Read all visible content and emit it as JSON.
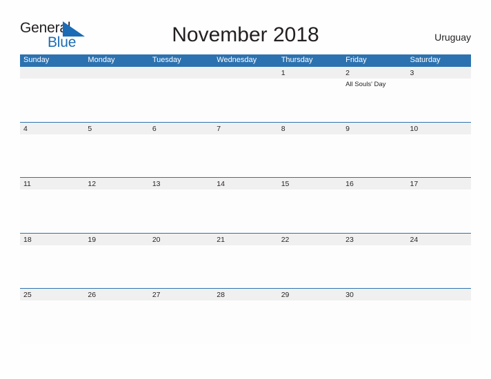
{
  "brand": {
    "name_part1": "General",
    "name_part2": "Blue",
    "triangle_icon": "blue-triangle-icon",
    "color_dark": "#231f20",
    "color_blue": "#1b6cb5"
  },
  "header": {
    "title": "November 2018",
    "region": "Uruguay"
  },
  "colors": {
    "header_blue": "#2c72b0",
    "band_gray": "#f0f0f0",
    "text": "#231f20",
    "page_background": "#fefefe"
  },
  "calendar": {
    "month": "November",
    "year": "2018",
    "weekdays": [
      "Sunday",
      "Monday",
      "Tuesday",
      "Wednesday",
      "Thursday",
      "Friday",
      "Saturday"
    ],
    "weeks": [
      [
        {
          "day": "",
          "event": ""
        },
        {
          "day": "",
          "event": ""
        },
        {
          "day": "",
          "event": ""
        },
        {
          "day": "",
          "event": ""
        },
        {
          "day": "1",
          "event": ""
        },
        {
          "day": "2",
          "event": "All Souls' Day"
        },
        {
          "day": "3",
          "event": ""
        }
      ],
      [
        {
          "day": "4",
          "event": ""
        },
        {
          "day": "5",
          "event": ""
        },
        {
          "day": "6",
          "event": ""
        },
        {
          "day": "7",
          "event": ""
        },
        {
          "day": "8",
          "event": ""
        },
        {
          "day": "9",
          "event": ""
        },
        {
          "day": "10",
          "event": ""
        }
      ],
      [
        {
          "day": "11",
          "event": ""
        },
        {
          "day": "12",
          "event": ""
        },
        {
          "day": "13",
          "event": ""
        },
        {
          "day": "14",
          "event": ""
        },
        {
          "day": "15",
          "event": ""
        },
        {
          "day": "16",
          "event": ""
        },
        {
          "day": "17",
          "event": ""
        }
      ],
      [
        {
          "day": "18",
          "event": ""
        },
        {
          "day": "19",
          "event": ""
        },
        {
          "day": "20",
          "event": ""
        },
        {
          "day": "21",
          "event": ""
        },
        {
          "day": "22",
          "event": ""
        },
        {
          "day": "23",
          "event": ""
        },
        {
          "day": "24",
          "event": ""
        }
      ],
      [
        {
          "day": "25",
          "event": ""
        },
        {
          "day": "26",
          "event": ""
        },
        {
          "day": "27",
          "event": ""
        },
        {
          "day": "28",
          "event": ""
        },
        {
          "day": "29",
          "event": ""
        },
        {
          "day": "30",
          "event": ""
        },
        {
          "day": "",
          "event": ""
        }
      ]
    ]
  }
}
